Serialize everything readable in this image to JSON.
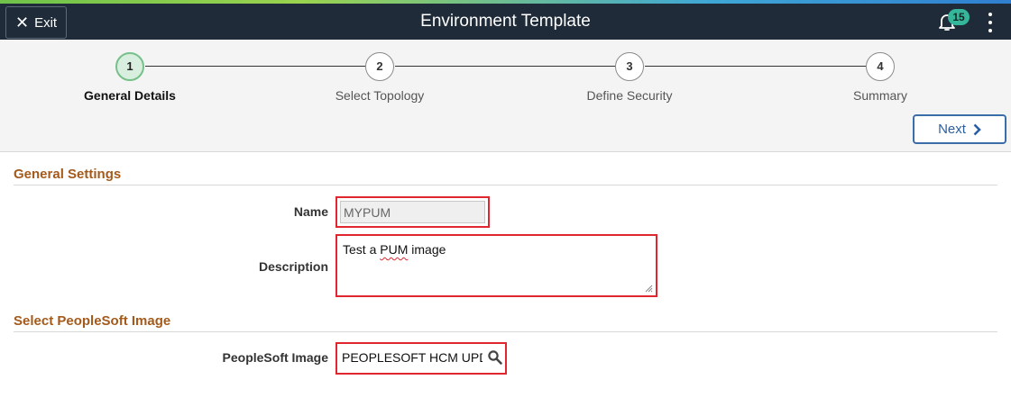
{
  "header": {
    "exit_label": "Exit",
    "title": "Environment Template",
    "notification_count": "15"
  },
  "train": {
    "steps": [
      {
        "number": "1",
        "label": "General Details",
        "active": true
      },
      {
        "number": "2",
        "label": "Select Topology",
        "active": false
      },
      {
        "number": "3",
        "label": "Define Security",
        "active": false
      },
      {
        "number": "4",
        "label": "Summary",
        "active": false
      }
    ],
    "next_label": "Next"
  },
  "general_settings": {
    "title": "General Settings",
    "name_label": "Name",
    "name_value": "MYPUM",
    "description_label": "Description",
    "description_prefix": "Test a ",
    "description_misspelled": "PUM",
    "description_suffix": " image"
  },
  "image_section": {
    "title": "Select PeopleSoft Image",
    "image_label": "PeopleSoft Image",
    "image_value": "PEOPLESOFT HCM UPDATE IMAGE"
  },
  "colors": {
    "topbar": "#1f2b38",
    "section_title": "#a35a1b",
    "highlight": "#e0262f",
    "next_button": "#2c5f9e",
    "active_step": "#76c089"
  }
}
